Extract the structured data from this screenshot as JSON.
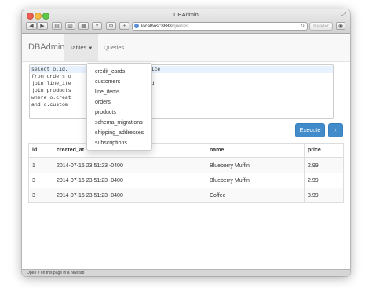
{
  "window": {
    "title": "DBAdmin",
    "url_host": "localhost:8888",
    "url_path": "/queries",
    "reader_label": "Reader",
    "status_text": "Open # on this page in a new tab"
  },
  "navbar": {
    "brand": "DBAdmin",
    "tables_label": "Tables",
    "queries_label": "Queries"
  },
  "query": {
    "lines": [
      "select o.id,",
      "from orders o",
      "join line_ite",
      "join products",
      "where o.creat",
      "and o.custom"
    ],
    "fragments": [
      "o.price",
      "er_id",
      "t_id"
    ]
  },
  "actions": {
    "execute_label": "Execute",
    "grid_icon": "grid-icon"
  },
  "table_menu": {
    "items": [
      "credit_cards",
      "customers",
      "line_items",
      "orders",
      "products",
      "schema_migrations",
      "shipping_addresses",
      "subscriptions"
    ]
  },
  "results": {
    "columns": [
      "id",
      "created_at",
      "name",
      "price"
    ],
    "rows": [
      [
        "1",
        "2014-07-16 23:51:23 -0400",
        "Blueberry Muffin",
        "2.99"
      ],
      [
        "3",
        "2014-07-16 23:51:23 -0400",
        "Blueberry Muffin",
        "2.99"
      ],
      [
        "3",
        "2014-07-16 23:51:23 -0400",
        "Coffee",
        "3.99"
      ]
    ]
  }
}
